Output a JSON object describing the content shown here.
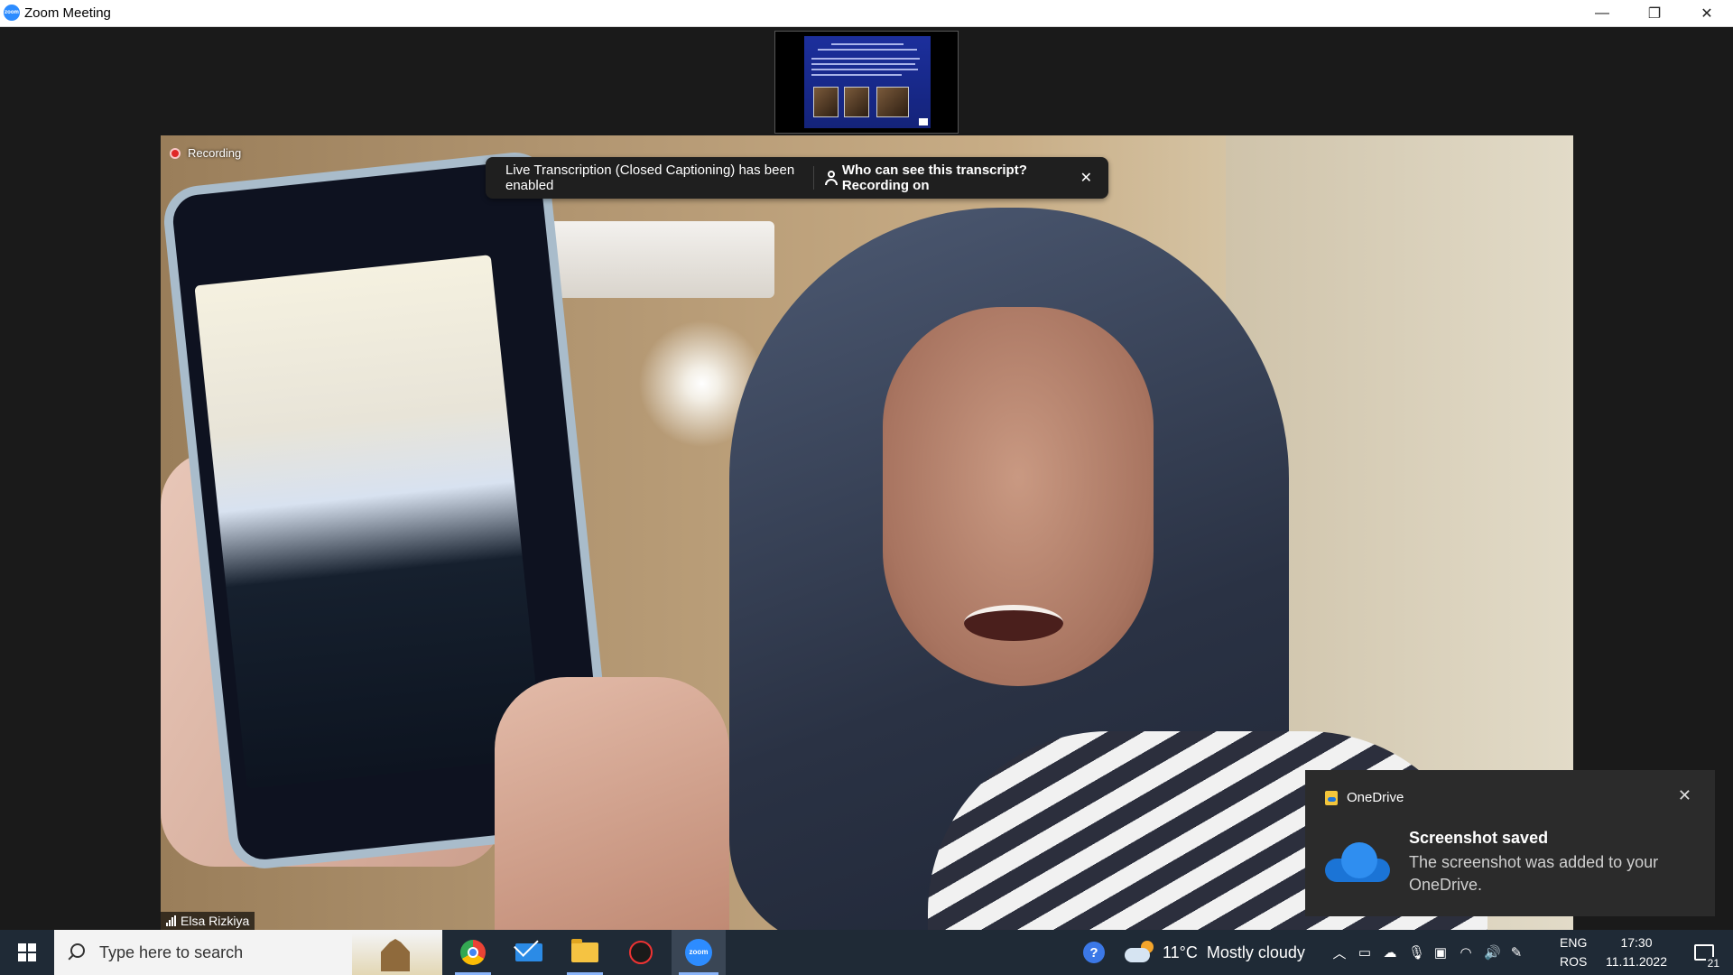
{
  "window": {
    "title": "Zoom Meeting",
    "app_icon_label": "zoom",
    "controls": {
      "minimize": "—",
      "maximize": "❐",
      "close": "✕"
    }
  },
  "meeting": {
    "recording_label": "Recording",
    "banner": {
      "message": "Live Transcription (Closed Captioning) has been enabled",
      "link": "Who can see this transcript? Recording on",
      "close": "✕"
    },
    "participant_name": "Elsa Rizkiya"
  },
  "toast": {
    "app": "OneDrive",
    "title": "Screenshot saved",
    "body": "The screenshot was added to your OneDrive.",
    "close": "✕"
  },
  "taskbar": {
    "search_placeholder": "Type here to search",
    "pinned_apps": [
      "chrome-icon",
      "mail-icon",
      "file-explorer-icon",
      "security-app-icon",
      "zoom-icon"
    ],
    "zoom_label": "zoom",
    "weather": {
      "temp": "11°C",
      "condition": "Mostly cloudy"
    },
    "tray_icons": [
      "chevron-up-icon",
      "meet-now-icon",
      "onedrive-sync-icon",
      "microphone-icon",
      "display-icon",
      "wifi-icon",
      "volume-icon",
      "pen-icon"
    ],
    "tray_glyphs": {
      "chevron": "︿",
      "meet": "▭",
      "sync": "☁",
      "mic": "🎙",
      "display": "▣",
      "wifi": "◠",
      "volume": "🔊",
      "pen": "✎"
    },
    "help_glyph": "?",
    "language": {
      "line1": "ENG",
      "line2": "ROS"
    },
    "clock": {
      "time": "17:30",
      "date": "11.11.2022"
    },
    "notification_count": "21"
  },
  "colors": {
    "zoom_blue": "#2d8cff",
    "taskbar_bg": "#1f2a36",
    "toast_bg": "#2b2b2b",
    "banner_bg": "#1f1f1f",
    "record_red": "#e02828"
  }
}
